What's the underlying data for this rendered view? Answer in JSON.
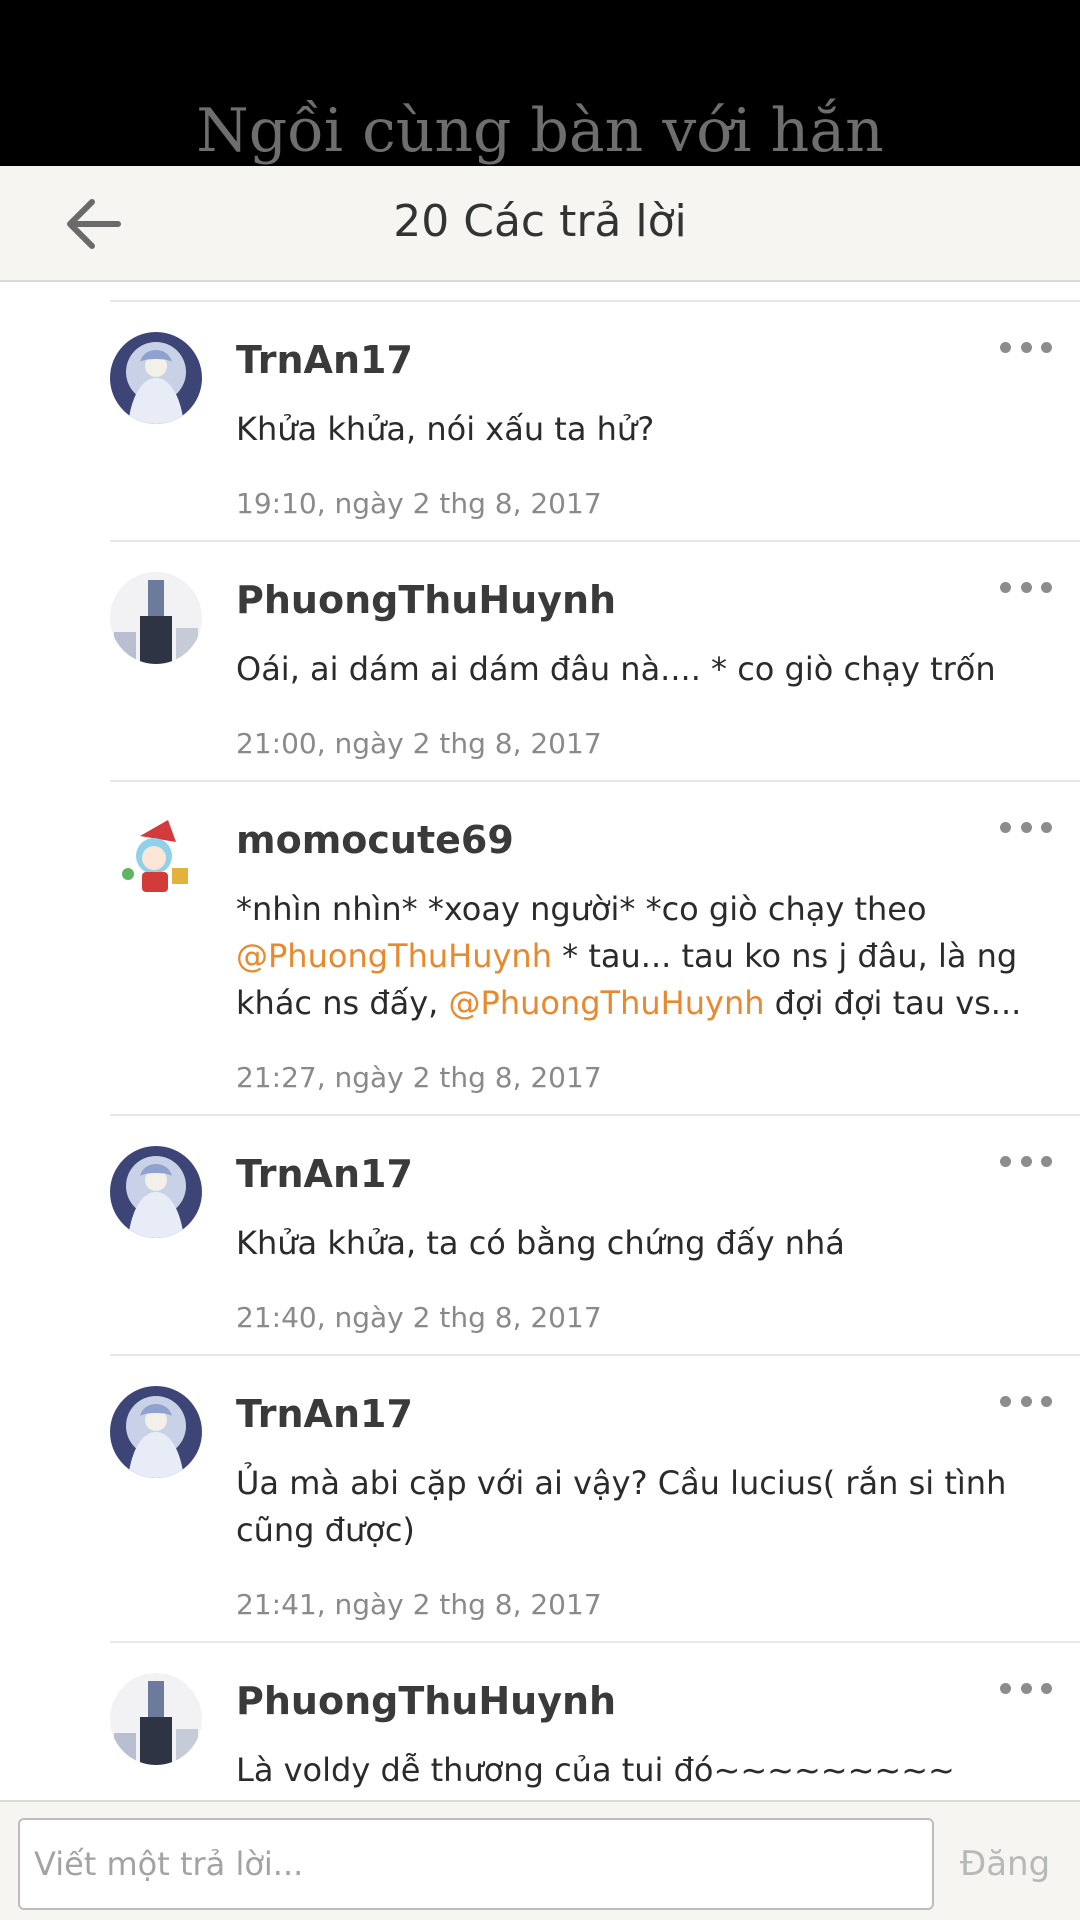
{
  "story": {
    "title": "Ngồi cùng bàn với hắn"
  },
  "header": {
    "title": "20 Các trả lời",
    "back_icon": "arrow-left-icon"
  },
  "comments": [
    {
      "author": "TrnAn17",
      "text": "Khửa khửa, nói xấu ta hử?",
      "time": "19:10, ngày 2 thg 8, 2017",
      "avatar": "anime-moon-girl"
    },
    {
      "author": "PhuongThuHuynh",
      "text": "Oái, ai dám ai dám đâu nà.... * co giò chạy trốn",
      "time": "21:00, ngày 2 thg 8, 2017",
      "avatar": "city-tower-photo"
    },
    {
      "author": "momocute69",
      "text_parts": [
        "*nhìn nhìn* *xoay người* *co giò chạy theo ",
        "@PhuongThuHuynh",
        " * tau... tau ko ns j đâu, là ng khác ns đấy, ",
        "@PhuongThuHuynh",
        " đợi đợi tau vs..."
      ],
      "time": "21:27, ngày 2 thg 8, 2017",
      "avatar": "chibi-santa-girl"
    },
    {
      "author": "TrnAn17",
      "text": "Khửa khửa, ta có bằng chứng đấy nhá",
      "time": "21:40, ngày 2 thg 8, 2017",
      "avatar": "anime-moon-girl"
    },
    {
      "author": "TrnAn17",
      "text": "Ủa mà abi cặp với ai vậy? Cầu lucius( rắn si tình cũng được)",
      "time": "21:41, ngày 2 thg 8, 2017",
      "avatar": "anime-moon-girl"
    },
    {
      "author": "PhuongThuHuynh",
      "text": "Là voldy dễ thương của tui đó~~~~~~~~~",
      "time": "",
      "avatar": "city-tower-photo"
    }
  ],
  "reply": {
    "placeholder": "Viết một trả lời...",
    "post_label": "Đăng"
  },
  "colors": {
    "mention": "#e8892e",
    "header_bg": "#f6f5f1",
    "topbar_bg": "#000000"
  }
}
